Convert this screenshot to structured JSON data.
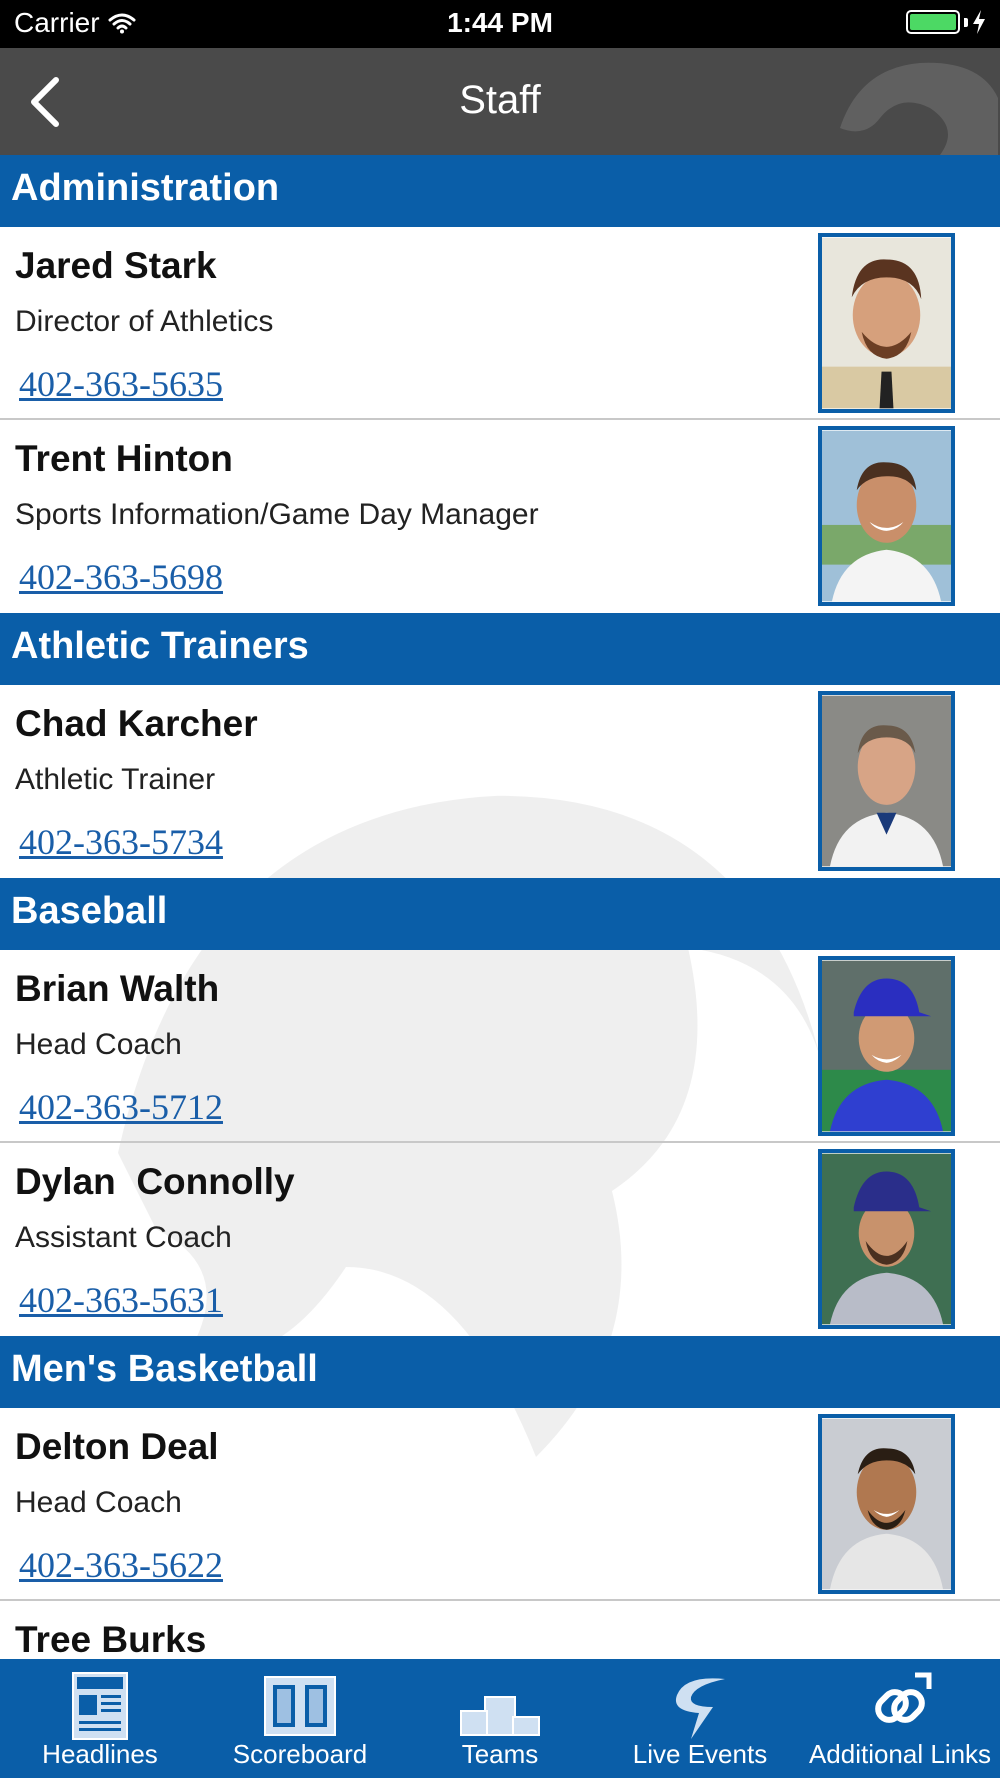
{
  "status_bar": {
    "carrier": "Carrier",
    "time": "1:44 PM"
  },
  "nav": {
    "title": "Staff"
  },
  "sections": [
    {
      "title": "Administration"
    },
    {
      "title": "Athletic Trainers"
    },
    {
      "title": "Baseball"
    },
    {
      "title": "Men's Basketball"
    }
  ],
  "staff": [
    {
      "name": "Jared Stark",
      "role": "Director of Athletics",
      "phone": "402-363-5635"
    },
    {
      "name": "Trent Hinton",
      "role": "Sports Information/Game Day Manager",
      "phone": "402-363-5698"
    },
    {
      "name": "Chad Karcher",
      "role": "Athletic Trainer",
      "phone": "402-363-5734"
    },
    {
      "name": "Brian Walth",
      "role": "Head Coach",
      "phone": "402-363-5712"
    },
    {
      "name": "Dylan  Connolly",
      "role": "Assistant Coach",
      "phone": "402-363-5631"
    },
    {
      "name": "Delton Deal",
      "role": "Head Coach",
      "phone": "402-363-5622"
    },
    {
      "name": "Tree Burks"
    }
  ],
  "tabs": [
    {
      "label": "Headlines",
      "icon": "newspaper-icon"
    },
    {
      "label": "Scoreboard",
      "icon": "scoreboard-icon"
    },
    {
      "label": "Teams",
      "icon": "podium-icon"
    },
    {
      "label": "Live Events",
      "icon": "live-events-icon"
    },
    {
      "label": "Additional Links",
      "icon": "links-icon"
    }
  ],
  "colors": {
    "accent": "#0a5ea8",
    "nav_bar": "#4a4a4a",
    "link": "#1a5ea8",
    "status_bar": "#000000"
  }
}
